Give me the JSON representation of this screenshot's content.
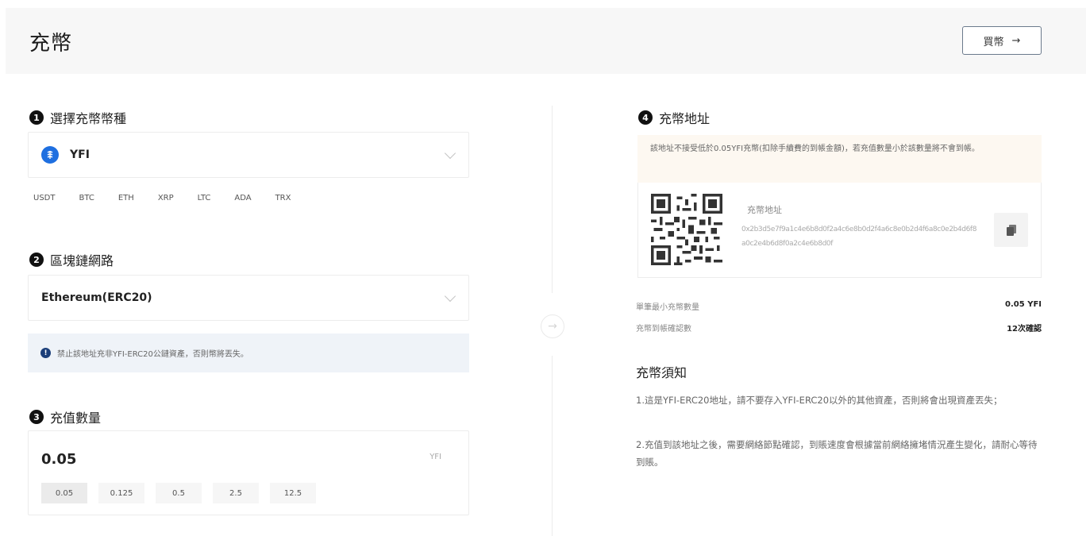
{
  "header": {
    "title": "充幣",
    "buy_label": "買幣",
    "buy_arrow": "→"
  },
  "section1": {
    "num": "1",
    "title": "選擇充幣幣種",
    "selected_coin": "YFI",
    "coin_icon": "yfi-icon",
    "quick_coins": [
      "USDT",
      "BTC",
      "ETH",
      "XRP",
      "LTC",
      "ADA",
      "TRX"
    ]
  },
  "section2": {
    "num": "2",
    "title": "區塊鏈網路",
    "network": "Ethereum(ERC20)",
    "warning": "禁止該地址充非YFI-ERC20公鏈資產，否則幣將丟失。"
  },
  "section3": {
    "num": "3",
    "title": "充值數量",
    "amount": "0.05",
    "unit": "YFI",
    "presets": [
      "0.05",
      "0.125",
      "0.5",
      "2.5",
      "12.5"
    ],
    "selected_preset": "0.05"
  },
  "section4": {
    "num": "4",
    "title": "充幣地址",
    "notice": "該地址不接受低於0.05YFI充幣(扣除手續費的到帳金額)，若充值數量小於該數量將不會到帳。",
    "address_label": "充幣地址",
    "address": "0x2b3d5e7f9a1c4e6b8d0f2a4c6e8b0d2f4a6c8e0b2d4f6a8c0e2b4d6f8a0c2e4b6d8f0a2c4e6b8d0f"
  },
  "details": [
    {
      "label": "單筆最小充幣數量",
      "value": "0.05 YFI"
    },
    {
      "label": "充幣到帳確認數",
      "value": "12次確認"
    }
  ],
  "notes": {
    "title": "充幣須知",
    "items": [
      "1.這是YFI-ERC20地址，請不要存入YFI-ERC20以外的其他資產，否則將會出現資產丟失；",
      "2.充值到該地址之後，需要網絡節點確認，到賬速度會根據當前網絡擁堵情況產生變化，請耐心等待到賬。"
    ]
  },
  "colors": {
    "accent": "#1e6fe0",
    "warning_bg": "#fdf8f1",
    "info_bg": "#eff3f8",
    "info_icon": "#1c3f7a"
  }
}
